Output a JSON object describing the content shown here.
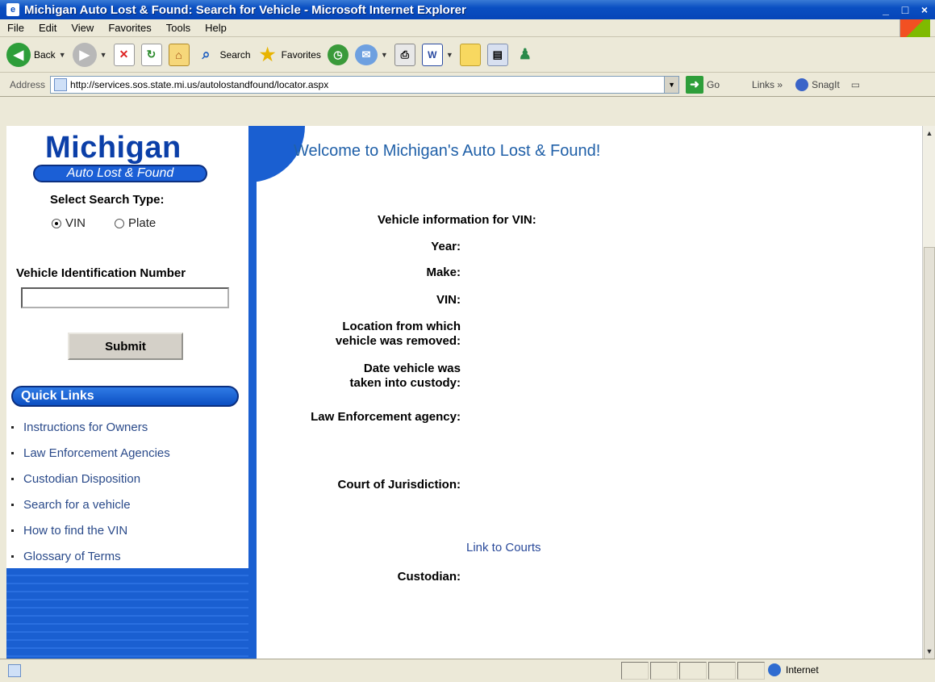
{
  "window": {
    "title": "Michigan Auto Lost & Found: Search for Vehicle - Microsoft Internet Explorer",
    "controls": [
      "_",
      "□",
      "×"
    ]
  },
  "menu": [
    "File",
    "Edit",
    "View",
    "Favorites",
    "Tools",
    "Help"
  ],
  "toolbar": {
    "back_label": "Back",
    "search_label": "Search",
    "favorites_label": "Favorites"
  },
  "address": {
    "label": "Address",
    "url": "http://services.sos.state.mi.us/autolostandfound/locator.aspx",
    "go_label": "Go",
    "links_label": "Links »",
    "snagit_label": "SnagIt"
  },
  "sidebar": {
    "logo_title": "Michigan",
    "logo_subtitle": "Auto Lost & Found",
    "search_type_label": "Select Search Type:",
    "options": [
      "VIN",
      "Plate"
    ],
    "selected_option": "VIN",
    "vin_label": "Vehicle Identification Number",
    "vin_value": "",
    "submit_label": "Submit",
    "quick_links_header": "Quick Links",
    "quick_links": [
      "Instructions for Owners",
      "Law Enforcement Agencies",
      "Custodian Disposition",
      "Search for a vehicle",
      "How to find the VIN",
      "Glossary of Terms"
    ]
  },
  "main": {
    "welcome": "Welcome to Michigan's Auto Lost & Found!",
    "info_header": "Vehicle information for VIN:",
    "year_label": "Year:",
    "make_label": "Make:",
    "vin_label": "VIN:",
    "location_label_1": "Location from which",
    "location_label_2": "vehicle was removed:",
    "date_label_1": "Date vehicle was",
    "date_label_2": "taken into custody:",
    "agency_label": "Law Enforcement agency:",
    "court_label": "Court of Jurisdiction:",
    "courts_link": "Link to Courts",
    "custodian_label": "Custodian:"
  },
  "status": {
    "zone": "Internet"
  }
}
